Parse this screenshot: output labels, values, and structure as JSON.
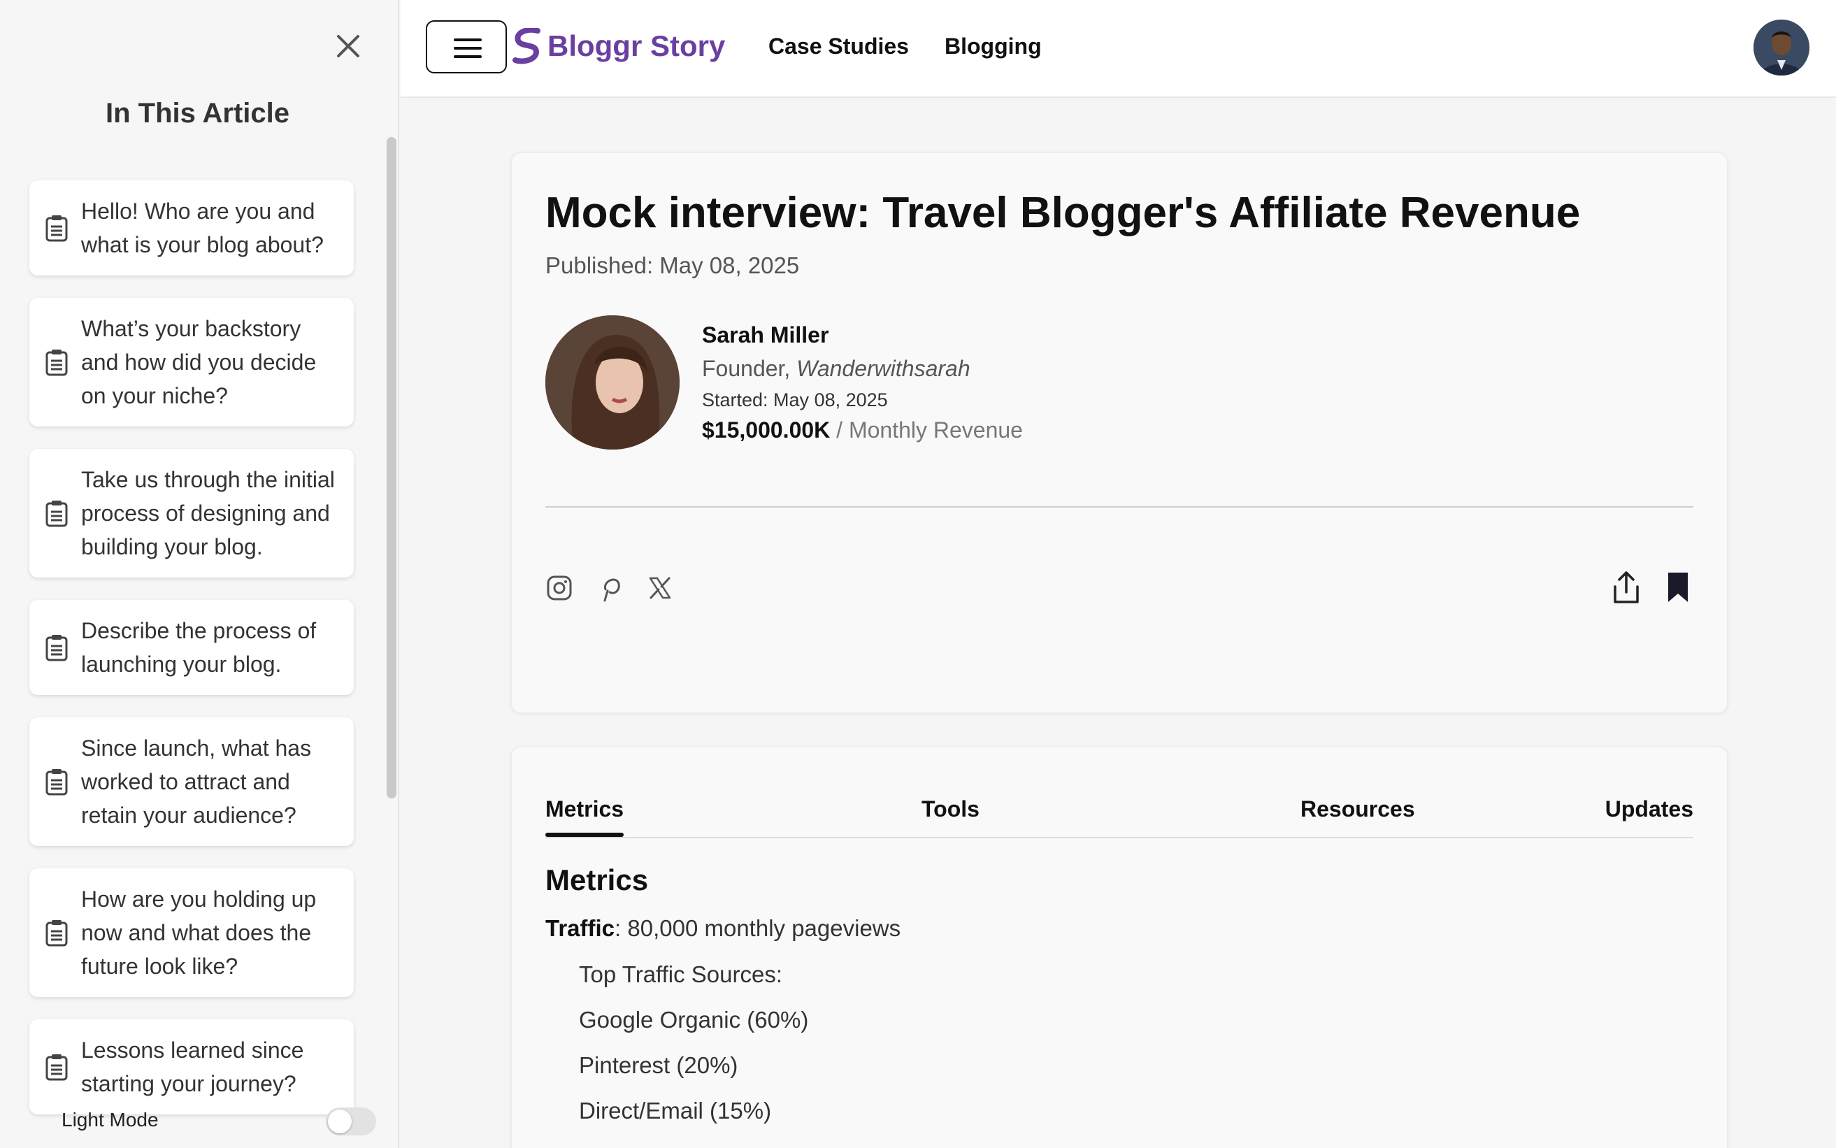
{
  "sidebar": {
    "title": "In This Article",
    "items": [
      {
        "label": "Hello! Who are you and what is your blog about?"
      },
      {
        "label": "What’s your backstory and how did you decide on your niche?"
      },
      {
        "label": "Take us through the initial process of designing and building your blog."
      },
      {
        "label": "Describe the process of launching your blog."
      },
      {
        "label": "Since launch, what has worked to attract and retain your audience?"
      },
      {
        "label": "How are you holding up now and what does the future look like?"
      },
      {
        "label": "Lessons learned since starting your journey?"
      }
    ],
    "mode_label": "Light Mode",
    "mode_toggle_on": false
  },
  "header": {
    "logo_text": "Bloggr Story",
    "nav": [
      "Case Studies",
      "Blogging"
    ],
    "brand_color": "#6b3fa0"
  },
  "article": {
    "title": "Mock interview: Travel Blogger's Affiliate Revenue",
    "published": "Published: May 08, 2025",
    "author": {
      "name": "Sarah Miller",
      "role_prefix": "Founder,",
      "company": "Wanderwithsarah",
      "started": "Started: May 08, 2025",
      "revenue": "$15,000.00K",
      "revenue_suffix": "/ Monthly Revenue"
    },
    "social_icons": [
      "instagram-icon",
      "pinterest-icon",
      "x-icon"
    ],
    "actions": [
      "share-icon",
      "bookmark-icon"
    ]
  },
  "tabs": {
    "items": [
      "Metrics",
      "Tools",
      "Resources",
      "Updates"
    ],
    "active": "Metrics"
  },
  "metrics": {
    "title": "Metrics",
    "traffic_label": "Traffic",
    "traffic_value": ": 80,000 monthly pageviews",
    "sources_label": "Top Traffic Sources:",
    "sources": [
      "Google Organic (60%)",
      "Pinterest (20%)",
      "Direct/Email (15%)"
    ]
  }
}
